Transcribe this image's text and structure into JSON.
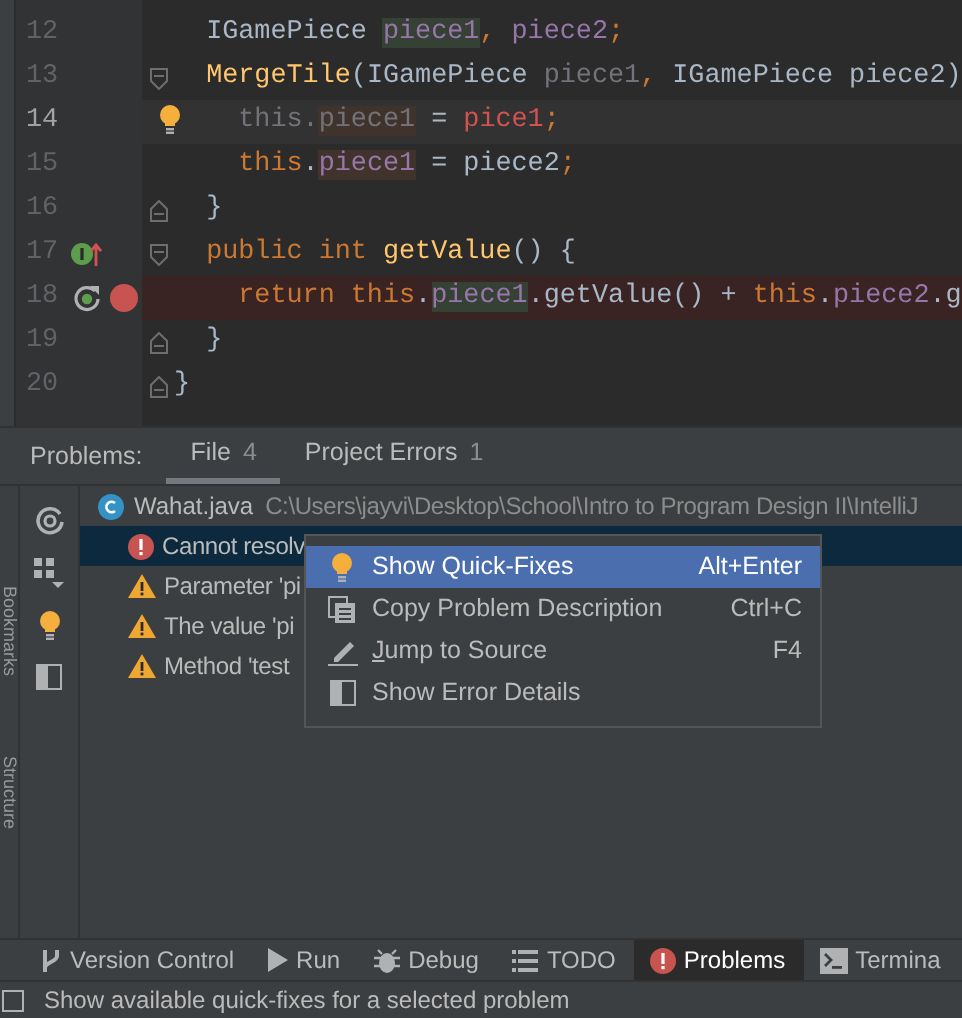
{
  "editor": {
    "lines": [
      {
        "number": "12",
        "current": false,
        "breakpoint": false,
        "fold_start": false,
        "fold_end": false,
        "hint": false,
        "implements": false,
        "rerun": false,
        "tokens": [
          {
            "text": "  IGamePiece ",
            "kind": "plain"
          },
          {
            "text": "piece1",
            "kind": "field-read"
          },
          {
            "text": ", ",
            "kind": "keyword"
          },
          {
            "text": "piece2",
            "kind": "field"
          },
          {
            "text": ";",
            "kind": "keyword"
          }
        ]
      },
      {
        "number": "13",
        "current": false,
        "breakpoint": false,
        "fold_start": true,
        "fold_end": false,
        "hint": false,
        "implements": false,
        "rerun": false,
        "tokens": [
          {
            "text": "  MergeTile",
            "kind": "method"
          },
          {
            "text": "(IGamePiece ",
            "kind": "plain"
          },
          {
            "text": "piece1",
            "kind": "unused"
          },
          {
            "text": ", ",
            "kind": "keyword"
          },
          {
            "text": "IGamePiece piece2)",
            "kind": "plain"
          }
        ]
      },
      {
        "number": "14",
        "current": true,
        "breakpoint": false,
        "fold_start": false,
        "fold_end": false,
        "hint": true,
        "implements": false,
        "rerun": false,
        "tokens": [
          {
            "text": "    this.",
            "kind": "unused"
          },
          {
            "text": "piece1",
            "kind": "unused-write"
          },
          {
            "text": " = ",
            "kind": "plain"
          },
          {
            "text": "pice1",
            "kind": "error"
          },
          {
            "text": ";",
            "kind": "keyword"
          }
        ]
      },
      {
        "number": "15",
        "current": false,
        "breakpoint": false,
        "fold_start": false,
        "fold_end": false,
        "hint": false,
        "implements": false,
        "rerun": false,
        "tokens": [
          {
            "text": "    this",
            "kind": "keyword"
          },
          {
            "text": ".",
            "kind": "plain"
          },
          {
            "text": "piece1",
            "kind": "field-write"
          },
          {
            "text": " = piece2",
            "kind": "plain"
          },
          {
            "text": ";",
            "kind": "keyword"
          }
        ]
      },
      {
        "number": "16",
        "current": false,
        "breakpoint": false,
        "fold_start": false,
        "fold_end": true,
        "hint": false,
        "implements": false,
        "rerun": false,
        "tokens": [
          {
            "text": "  }",
            "kind": "plain"
          }
        ]
      },
      {
        "number": "17",
        "current": false,
        "breakpoint": false,
        "fold_start": true,
        "fold_end": false,
        "hint": false,
        "implements": true,
        "rerun": false,
        "tokens": [
          {
            "text": "  public int ",
            "kind": "keyword"
          },
          {
            "text": "getValue",
            "kind": "method"
          },
          {
            "text": "() {",
            "kind": "plain"
          }
        ]
      },
      {
        "number": "18",
        "current": false,
        "breakpoint": true,
        "fold_start": false,
        "fold_end": false,
        "hint": false,
        "implements": false,
        "rerun": true,
        "tokens": [
          {
            "text": "    return this",
            "kind": "keyword"
          },
          {
            "text": ".",
            "kind": "plain"
          },
          {
            "text": "piece1",
            "kind": "field-read"
          },
          {
            "text": ".getValue() + ",
            "kind": "plain"
          },
          {
            "text": "this",
            "kind": "keyword"
          },
          {
            "text": ".",
            "kind": "plain"
          },
          {
            "text": "piece2",
            "kind": "field"
          },
          {
            "text": ".g",
            "kind": "plain"
          }
        ]
      },
      {
        "number": "19",
        "current": false,
        "breakpoint": false,
        "fold_start": false,
        "fold_end": true,
        "hint": false,
        "implements": false,
        "rerun": false,
        "tokens": [
          {
            "text": "  }",
            "kind": "plain"
          }
        ]
      },
      {
        "number": "20",
        "current": false,
        "breakpoint": false,
        "fold_start": false,
        "fold_end": true,
        "hint": false,
        "implements": false,
        "rerun": false,
        "tokens": [
          {
            "text": "}",
            "kind": "plain"
          }
        ]
      }
    ]
  },
  "side_strip": [
    "Bookmarks",
    "Structure"
  ],
  "problems": {
    "title": "Problems:",
    "tabs": [
      {
        "label": "File",
        "count": "4",
        "selected": true
      },
      {
        "label": "Project Errors",
        "count": "1",
        "selected": false
      }
    ],
    "file": {
      "name": "Wahat.java",
      "path": "C:\\Users\\jayvi\\Desktop\\School\\Intro to Program Design II\\IntelliJ"
    },
    "items": [
      {
        "text": "Cannot resolv",
        "kind": "error",
        "selected": true
      },
      {
        "text": "Parameter 'pi",
        "kind": "warning",
        "selected": false
      },
      {
        "text": "The value 'pi",
        "kind": "warning",
        "selected": false
      },
      {
        "text": "Method 'test",
        "kind": "warning",
        "selected": false
      }
    ]
  },
  "context_menu": {
    "items": [
      {
        "label": "Show Quick-Fixes",
        "shortcut": "Alt+Enter",
        "selected": true,
        "mnemonic": false
      },
      {
        "label": "Copy Problem Description",
        "shortcut": "Ctrl+C",
        "selected": false,
        "mnemonic": false
      },
      {
        "label": "Jump to Source",
        "shortcut": "F4",
        "selected": false,
        "mnemonic": true
      },
      {
        "label": "Show Error Details",
        "selected": false,
        "mnemonic": false
      }
    ]
  },
  "tool_windows": [
    {
      "label": "Version Control",
      "selected": false
    },
    {
      "label": "Run",
      "selected": false
    },
    {
      "label": "Debug",
      "selected": false
    },
    {
      "label": "TODO",
      "selected": false
    },
    {
      "label": "Problems",
      "selected": true
    },
    {
      "label": "Termina",
      "selected": false
    }
  ],
  "status_bar": {
    "text": "Show available quick-fixes for a selected problem"
  }
}
